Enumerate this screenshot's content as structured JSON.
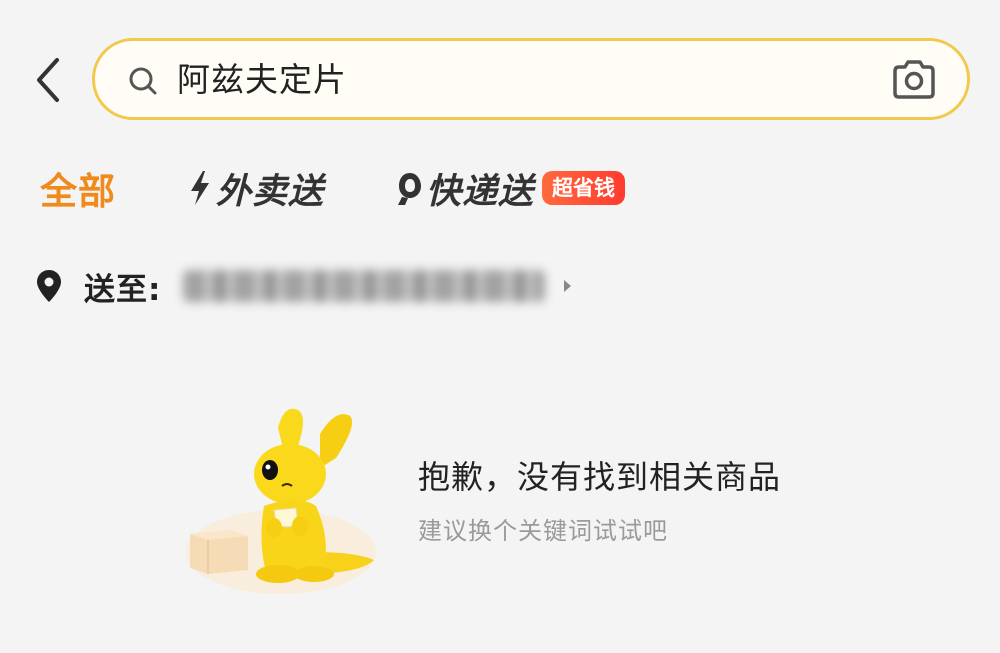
{
  "search": {
    "query": "阿兹夫定片"
  },
  "tabs": [
    {
      "label": "全部",
      "active": true
    },
    {
      "label": "外卖送",
      "icon": "lightning-icon"
    },
    {
      "label": "快递送",
      "icon": "courier-icon",
      "badge": "超省钱"
    }
  ],
  "address": {
    "label": "送至:"
  },
  "empty_state": {
    "title": "抱歉，没有找到相关商品",
    "subtitle": "建议换个关键词试试吧"
  },
  "colors": {
    "accent": "#f08a1c",
    "search_border": "#f2c94c",
    "badge": "#ff4a34",
    "background": "#f4f4f4"
  }
}
